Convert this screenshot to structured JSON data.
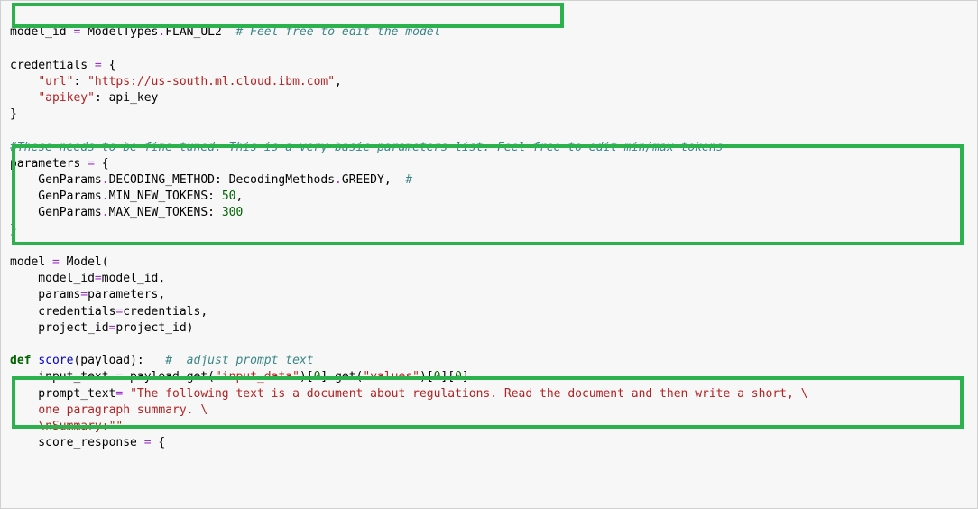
{
  "code": {
    "l01": {
      "a": "model_id ",
      "op": "=",
      "b": " ModelTypes",
      "dot": ".",
      "c": "FLAN_UL2  ",
      "comment": "# Feel free to edit the model"
    },
    "blank1": "",
    "l02": {
      "a": "credentials ",
      "op": "=",
      "b": " {"
    },
    "l03": {
      "indent": "    ",
      "k": "\"url\"",
      "colon": ": ",
      "v": "\"https://us-south.ml.cloud.ibm.com\"",
      "comma": ","
    },
    "l04": {
      "indent": "    ",
      "k": "\"apikey\"",
      "colon": ": api_key"
    },
    "l05": "}",
    "blank2": "",
    "l06": {
      "comment": "#These needs to be fine tuned. This is a very basic parameters list. Feel free to edit min/max tokens"
    },
    "l07": {
      "a": "parameters ",
      "op": "=",
      "b": " {"
    },
    "l08": {
      "indent": "    GenParams",
      "dot": ".",
      "m": "DECODING_METHOD: DecodingMethods",
      "dot2": ".",
      "v": "GREEDY,  ",
      "comment": "#"
    },
    "l09": {
      "indent": "    GenParams",
      "dot": ".",
      "m": "MIN_NEW_TOKENS: ",
      "num": "50",
      "comma": ","
    },
    "l10": {
      "indent": "    GenParams",
      "dot": ".",
      "m": "MAX_NEW_TOKENS: ",
      "num": "300"
    },
    "l11": "}",
    "blank3": "",
    "l12": {
      "a": "model ",
      "op": "=",
      "b": " Model("
    },
    "l13": {
      "indent": "    model_id",
      "op": "=",
      "b": "model_id,"
    },
    "l14": {
      "indent": "    params",
      "op": "=",
      "b": "parameters,"
    },
    "l15": {
      "indent": "    credentials",
      "op": "=",
      "b": "credentials,"
    },
    "l16": {
      "indent": "    project_id",
      "op": "=",
      "b": "project_id)"
    },
    "blank4": "",
    "l17": {
      "kw": "def",
      "sp": " ",
      "fn": "score",
      "rest": "(payload):   ",
      "comment": "#  adjust prompt text"
    },
    "l18": {
      "indent": "    input_text ",
      "op": "=",
      "b": " payload",
      "dot": ".",
      "m": "get(",
      "s1": "\"input_data\"",
      "r1": ")[",
      "n1": "0",
      "r2": "]",
      "dot2": ".",
      "m2": "get(",
      "s2": "\"values\"",
      "r3": ")[",
      "n2": "0",
      "r4": "][",
      "n3": "0",
      "r5": "]"
    },
    "l19": {
      "indent": "    prompt_text",
      "op": "=",
      "sp": " ",
      "s": "\"The following text is a document about regulations. Read the document and then write a short, \\"
    },
    "l20": {
      "indent": "    ",
      "s": "one paragraph summary. \\"
    },
    "l21": {
      "indent": "    ",
      "s1": "\\n",
      "s2": "Summary:\"\""
    },
    "l22": {
      "indent": "    score_response ",
      "op": "=",
      "b": " {"
    }
  }
}
